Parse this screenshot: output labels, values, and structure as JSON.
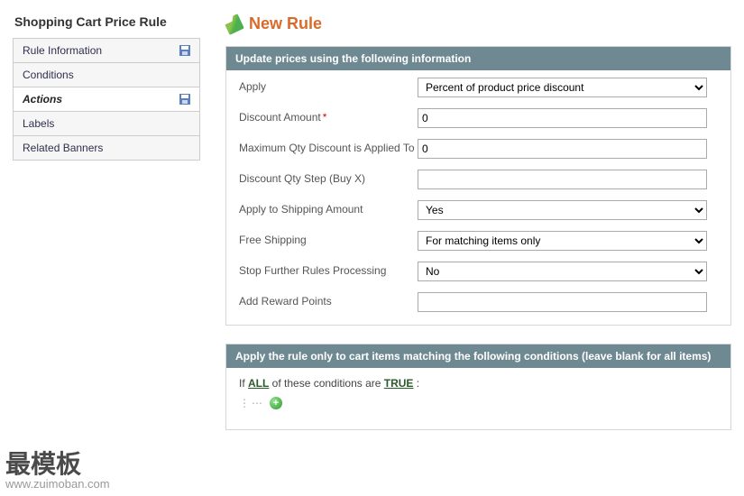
{
  "page": {
    "sidebar_title": "Shopping Cart Price Rule",
    "title": "New Rule"
  },
  "tabs": [
    {
      "label": "Rule Information",
      "active": false,
      "has_icon": true
    },
    {
      "label": "Conditions",
      "active": false,
      "has_icon": false
    },
    {
      "label": "Actions",
      "active": true,
      "has_icon": true
    },
    {
      "label": "Labels",
      "active": false,
      "has_icon": false
    },
    {
      "label": "Related Banners",
      "active": false,
      "has_icon": false
    }
  ],
  "fieldset1": {
    "legend": "Update prices using the following information",
    "apply_label": "Apply",
    "apply_value": "Percent of product price discount",
    "discount_amount_label": "Discount Amount",
    "discount_amount_value": "0",
    "max_qty_label": "Maximum Qty Discount is Applied To",
    "max_qty_value": "0",
    "qty_step_label": "Discount Qty Step (Buy X)",
    "qty_step_value": "",
    "apply_shipping_label": "Apply to Shipping Amount",
    "apply_shipping_value": "Yes",
    "free_shipping_label": "Free Shipping",
    "free_shipping_value": "For matching items only",
    "stop_rules_label": "Stop Further Rules Processing",
    "stop_rules_value": "No",
    "reward_points_label": "Add Reward Points",
    "reward_points_value": ""
  },
  "fieldset2": {
    "legend": "Apply the rule only to cart items matching the following conditions (leave blank for all items)",
    "cond_prefix": "If ",
    "cond_all": "ALL",
    "cond_mid": "  of these conditions are ",
    "cond_true": "TRUE",
    "cond_suffix": " :"
  },
  "watermark": {
    "cn": "最模板",
    "en": "www.zuimoban.com"
  }
}
